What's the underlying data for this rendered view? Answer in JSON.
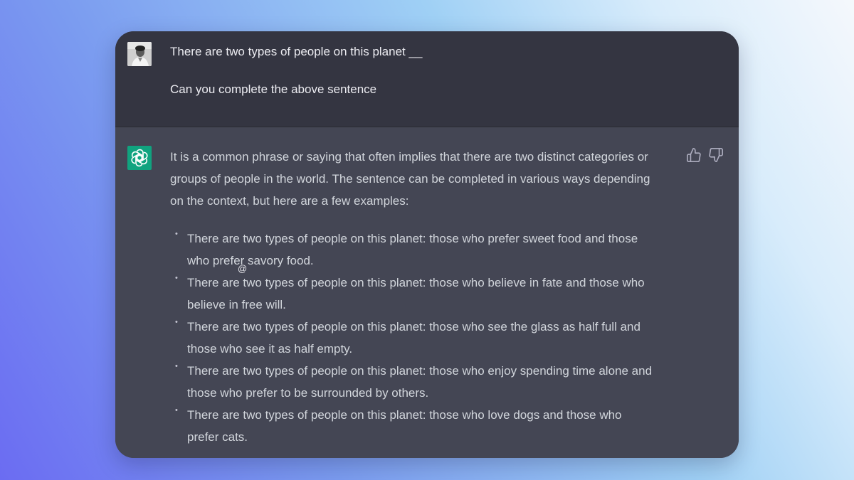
{
  "conversation": {
    "user_message": {
      "line1": "There are two types of people on this planet __",
      "line2": "Can you complete the above sentence"
    },
    "assistant_message": {
      "intro_lines": [
        "It is a common phrase or saying that often implies that there are two distinct categories or",
        "groups of people in the world. The sentence can be completed in various ways depending",
        "on the context, but here are a few examples:"
      ],
      "examples": [
        {
          "lines": [
            "There are two types of people on this planet: those who prefer sweet food and those",
            "who prefer savory food."
          ]
        },
        {
          "lines": [
            "There are two types of people on this planet: those who believe in fate and those who",
            "believe in free will."
          ]
        },
        {
          "lines": [
            "There are two types of people on this planet: those who see the glass as half full and",
            "those who see it as half empty."
          ]
        },
        {
          "lines": [
            "There are two types of people on this planet: those who enjoy spending time alone and",
            "those who prefer to be surrounded by others."
          ]
        },
        {
          "lines": [
            "There are two types of people on this planet: those who love dogs and those who",
            "prefer cats."
          ]
        }
      ],
      "bullet": "•"
    },
    "feedback": {
      "up_icon": "thumbs-up-icon",
      "down_icon": "thumbs-down-icon"
    },
    "cursor_glyph": "@"
  },
  "colors": {
    "user_bg": "#343541",
    "assistant_bg": "#444654",
    "logo_bg": "#10a37f",
    "text": "#d1d5db"
  }
}
